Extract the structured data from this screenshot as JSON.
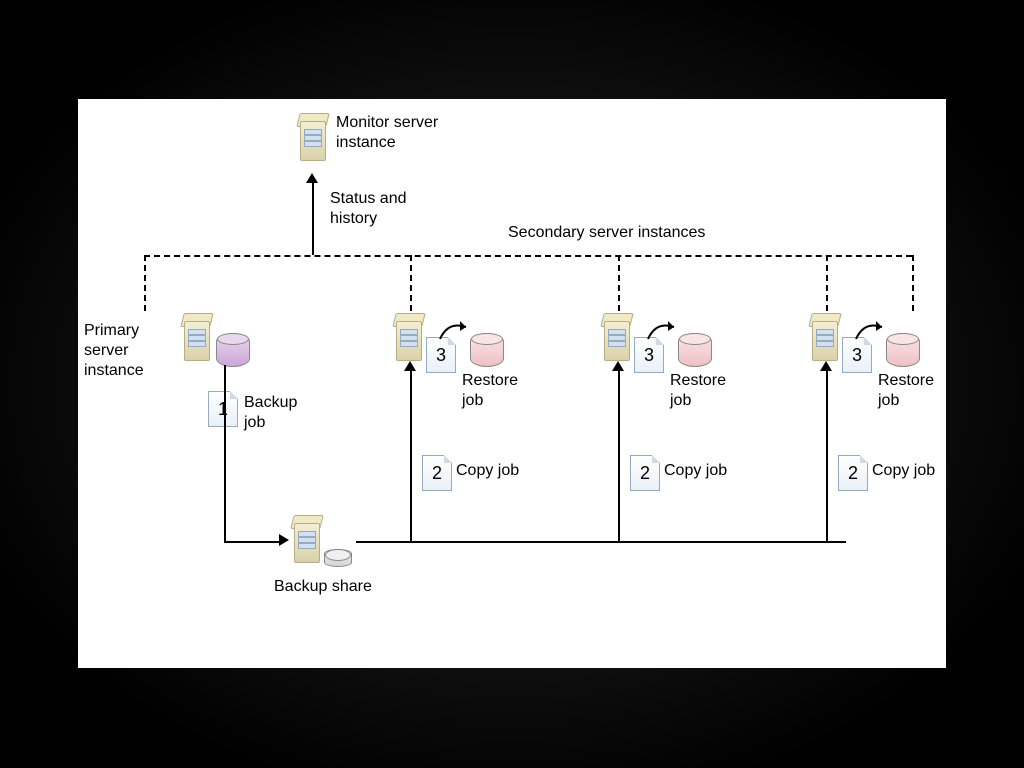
{
  "labels": {
    "monitor": "Monitor server\ninstance",
    "status": "Status and\nhistory",
    "secondary_header": "Secondary server instances",
    "primary": "Primary\nserver\ninstance",
    "backup_job": "Backup\njob",
    "backup_share": "Backup share",
    "step1": "1",
    "step2": "2",
    "step3": "3",
    "copy_job": "Copy job",
    "restore_job": "Restore\njob"
  }
}
